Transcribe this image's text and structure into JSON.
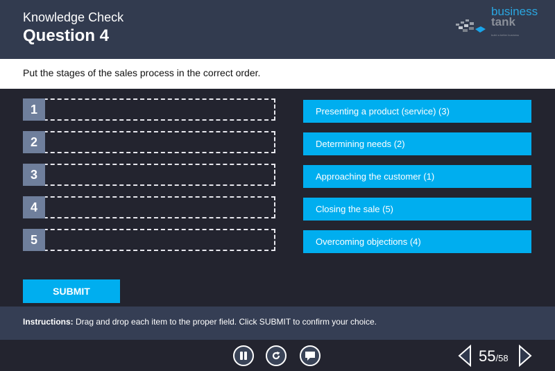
{
  "header": {
    "subtitle": "Knowledge Check",
    "title": "Question 4",
    "logo": {
      "word1": "business",
      "word2": "tank",
      "tagline": "build a better business"
    }
  },
  "question": {
    "prompt": "Put the stages of the sales process in the correct order."
  },
  "slots": [
    {
      "number": "1"
    },
    {
      "number": "2"
    },
    {
      "number": "3"
    },
    {
      "number": "4"
    },
    {
      "number": "5"
    }
  ],
  "items": [
    {
      "label": "Presenting a product (service) (3)"
    },
    {
      "label": "Determining needs (2)"
    },
    {
      "label": "Approaching the customer (1)"
    },
    {
      "label": "Closing the sale (5)"
    },
    {
      "label": "Overcoming objections (4)"
    }
  ],
  "submit": {
    "label": "SUBMIT"
  },
  "instructions": {
    "label": "Instructions:",
    "text": " Drag and drop each item to the proper field. Click SUBMIT to confirm your choice."
  },
  "player": {
    "controls": [
      {
        "icon": "pause-icon"
      },
      {
        "icon": "replay-icon"
      },
      {
        "icon": "comment-icon"
      }
    ],
    "page_current": "55",
    "page_total": "/58"
  },
  "colors": {
    "accent": "#00aeef",
    "header_bg": "#323b4f",
    "body_bg": "#23242f",
    "slot_number_bg": "#6f7f9c"
  }
}
